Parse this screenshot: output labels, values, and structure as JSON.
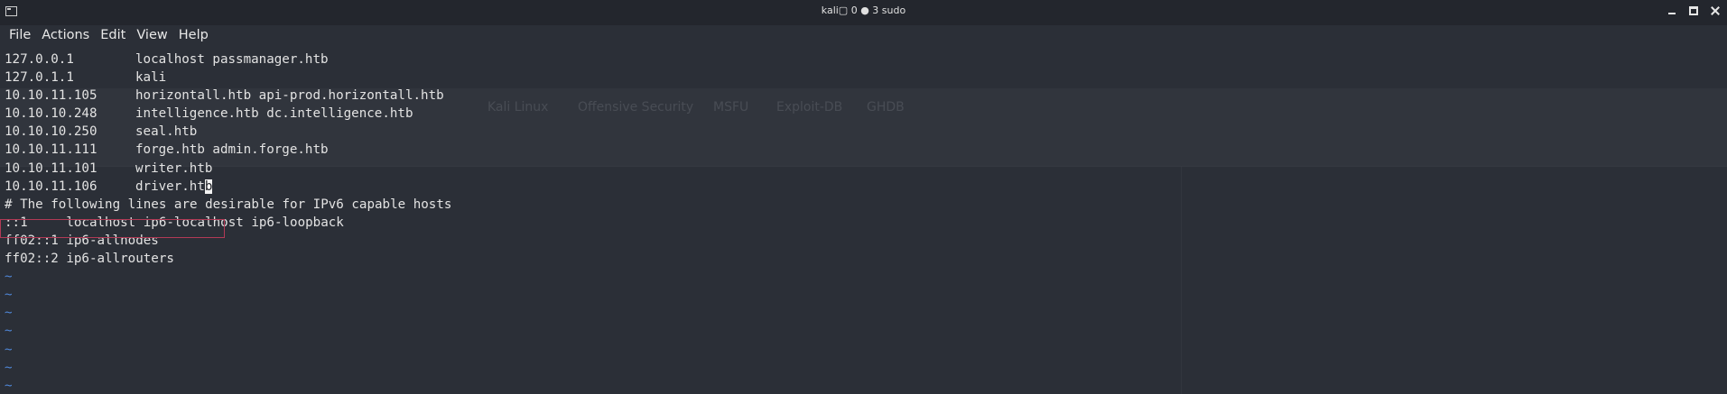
{
  "window": {
    "title": "kali▢ 0 ● 3 sudo",
    "icons": {
      "app": "terminal-icon",
      "minimize": "minimize-icon",
      "maximize": "maximize-icon",
      "close": "close-icon"
    }
  },
  "menubar": {
    "items": [
      "File",
      "Actions",
      "Edit",
      "View",
      "Help"
    ]
  },
  "editor": {
    "hosts": [
      {
        "ip": "127.0.0.1",
        "names": "localhost passmanager.htb"
      },
      {
        "ip": "127.0.1.1",
        "names": "kali"
      },
      {
        "ip": "10.10.11.105",
        "names": "horizontall.htb api-prod.horizontall.htb"
      },
      {
        "ip": "10.10.10.248",
        "names": "intelligence.htb dc.intelligence.htb"
      },
      {
        "ip": "10.10.10.250",
        "names": "seal.htb"
      },
      {
        "ip": "10.10.11.111",
        "names": "forge.htb admin.forge.htb"
      },
      {
        "ip": "10.10.11.101",
        "names": "writer.htb"
      }
    ],
    "current_line": {
      "ip": "10.10.11.106",
      "names_before_cursor": "driver.ht",
      "cursor_char": "b"
    },
    "comment": "# The following lines are desirable for IPv6 capable hosts",
    "ipv6_lines": [
      "::1     localhost ip6-localhost ip6-loopback",
      "ff02::1 ip6-allnodes",
      "ff02::2 ip6-allrouters"
    ],
    "empty_markers": [
      "~",
      "~",
      "~",
      "~",
      "~",
      "~",
      "~"
    ],
    "colors": {
      "background": "#2b2f37",
      "text": "#e3e3e3",
      "tilde": "#4f86d6",
      "highlight_border": "#b23a56"
    }
  },
  "background_ghost": {
    "bookmarks": [
      "Kali Linux",
      "Offensive Security",
      "MSFU",
      "Exploit-DB",
      "GHDB"
    ]
  }
}
